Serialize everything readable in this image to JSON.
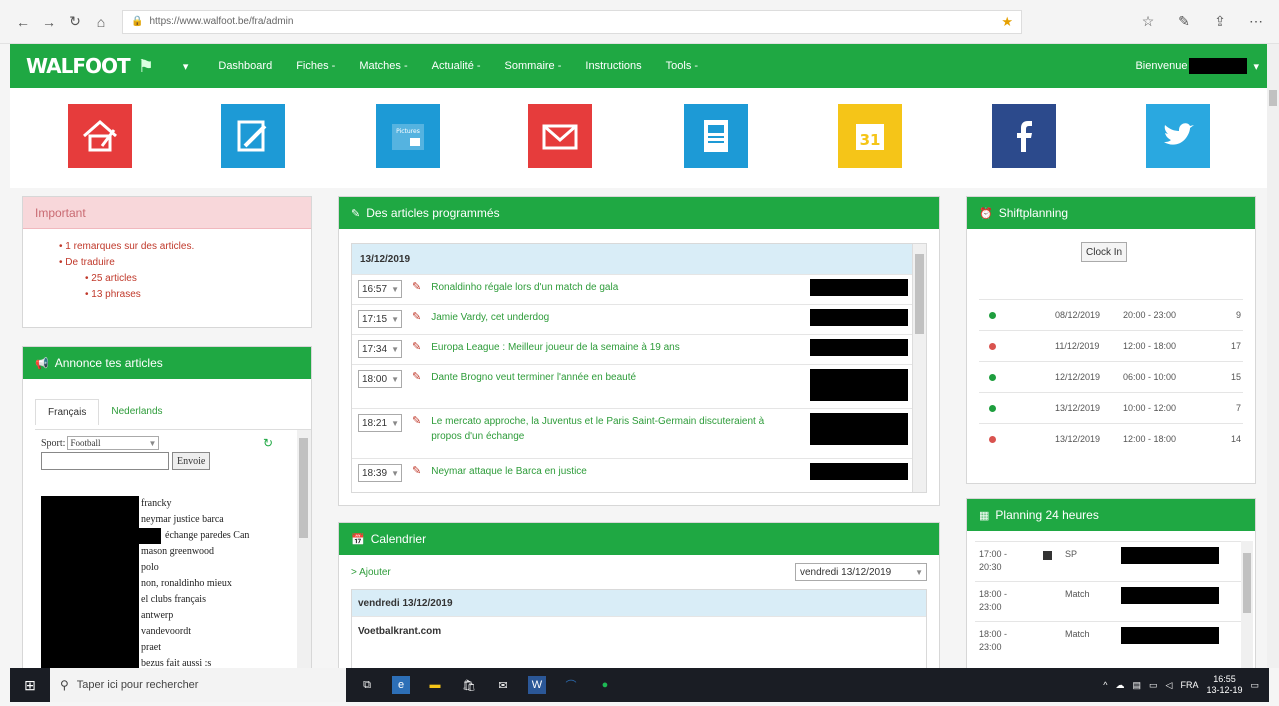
{
  "browser": {
    "url": "https://www.walfoot.be/fra/admin"
  },
  "nav": {
    "logo": "WALFOOT",
    "items": [
      "Dashboard",
      "Fiches -",
      "Matches -",
      "Actualité -",
      "Sommaire -",
      "Instructions",
      "Tools -"
    ],
    "welcome": "Bienvenue"
  },
  "tiles": [
    {
      "icon": "home-edit-icon",
      "color": "#e63c3c"
    },
    {
      "icon": "edit-document-icon",
      "color": "#1d9ad6"
    },
    {
      "icon": "pictures-icon",
      "color": "#1d9ad6",
      "label": "Pictures"
    },
    {
      "icon": "mail-icon",
      "color": "#e63c3c"
    },
    {
      "icon": "article-icon",
      "color": "#1d9ad6"
    },
    {
      "icon": "calendar-icon",
      "color": "#f5c518",
      "label": "31"
    },
    {
      "icon": "facebook-icon",
      "color": "#2c4a8c"
    },
    {
      "icon": "twitter-icon",
      "color": "#2aa8e0"
    }
  ],
  "important": {
    "title": "Important",
    "items": [
      "1 remarques sur des articles.",
      "De traduire"
    ],
    "sub_items": [
      "25 articles",
      "13 phrases"
    ]
  },
  "articles": {
    "title": "Des articles programmés",
    "date": "13/12/2019",
    "rows": [
      {
        "time": "16:57",
        "title": "Ronaldinho régale lors d'un match de gala"
      },
      {
        "time": "17:15",
        "title": "Jamie Vardy, cet underdog"
      },
      {
        "time": "17:34",
        "title": "Europa League : Meilleur joueur de la semaine à 19 ans"
      },
      {
        "time": "18:00",
        "title": "Dante Brogno veut terminer l'année en beauté"
      },
      {
        "time": "18:21",
        "title": "Le mercato approche, la Juventus et le Paris Saint-Germain discuteraient à propos d'un échange"
      },
      {
        "time": "18:39",
        "title": "Neymar attaque le Barca en justice"
      }
    ]
  },
  "annonce": {
    "title": "Annonce tes articles",
    "tabs": [
      "Français",
      "Nederlands"
    ],
    "sport_label": "Sport:",
    "sport_value": "Football",
    "send": "Envoie",
    "words": [
      "francky",
      "neymar justice barca",
      "échange paredes Can",
      "mason greenwood",
      "polo",
      "non, ronaldinho mieux",
      "el clubs français",
      "antwerp",
      "vandevoordt",
      "praet",
      "bezus fait aussi :s"
    ]
  },
  "calendar": {
    "title": "Calendrier",
    "add": "> Ajouter",
    "select": "vendredi 13/12/2019",
    "day_header": "vendredi 13/12/2019",
    "item": "Voetbalkrant.com"
  },
  "shift": {
    "title": "Shiftplanning",
    "clock": "Clock In",
    "rows": [
      {
        "status": "green",
        "date": "08/12/2019",
        "time": "20:00 - 23:00",
        "num": "9"
      },
      {
        "status": "red",
        "date": "11/12/2019",
        "time": "12:00 - 18:00",
        "num": "17"
      },
      {
        "status": "green",
        "date": "12/12/2019",
        "time": "06:00 - 10:00",
        "num": "15"
      },
      {
        "status": "green",
        "date": "13/12/2019",
        "time": "10:00 - 12:00",
        "num": "7"
      },
      {
        "status": "red",
        "date": "13/12/2019",
        "time": "12:00 - 18:00",
        "num": "14"
      }
    ]
  },
  "planning": {
    "title": "Planning 24 heures",
    "rows": [
      {
        "time1": "17:00 -",
        "time2": "20:30",
        "type": "SP"
      },
      {
        "time1": "18:00 -",
        "time2": "23:00",
        "type": "Match"
      },
      {
        "time1": "18:00 -",
        "time2": "23:00",
        "type": "Match"
      }
    ]
  },
  "taskbar": {
    "search": "Taper ici pour rechercher",
    "lang": "FRA",
    "time": "16:55",
    "date": "13-12-19"
  },
  "colors": {
    "green": "#1fa843",
    "dot_green": "#1e9e3e",
    "dot_red": "#d9534f"
  }
}
